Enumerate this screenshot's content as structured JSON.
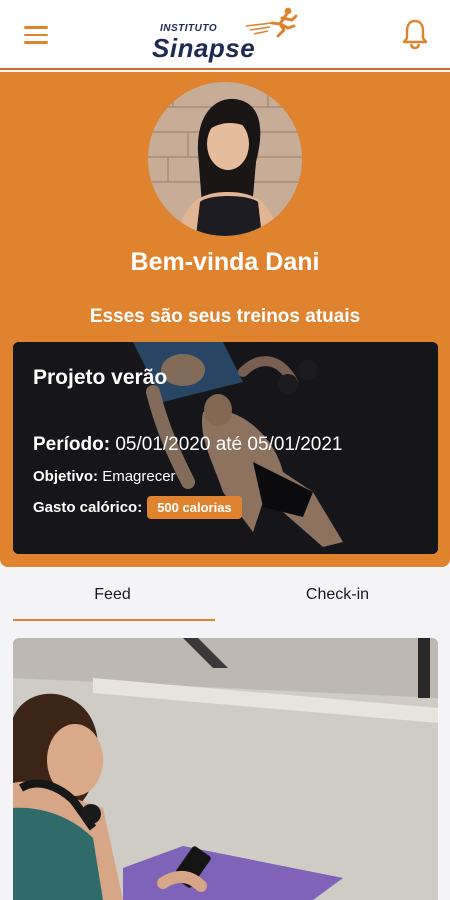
{
  "header": {
    "menu_icon": "hamburger-menu-icon",
    "logo_small": "INSTITUTO",
    "logo_big": "Sinapse",
    "bell_icon": "bell-icon",
    "accent": "#e0832f",
    "brand_dark": "#1d2a52"
  },
  "profile": {
    "greeting": "Bem-vinda Dani",
    "subtitle": "Esses são seus treinos atuais"
  },
  "workout": {
    "title": "Projeto verão",
    "period_label": "Período:",
    "period_value": "05/01/2020 até 05/01/2021",
    "goal_label": "Objetivo:",
    "goal_value": "Emagrecer",
    "calories_label": "Gasto calórico:",
    "calories_badge": "500 calorias"
  },
  "tabs": [
    {
      "label": "Feed",
      "active": true
    },
    {
      "label": "Check-in",
      "active": false
    }
  ]
}
